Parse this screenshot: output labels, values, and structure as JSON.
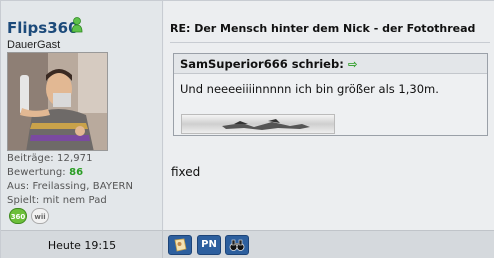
{
  "user": {
    "name": "Flips360",
    "title": "DauerGast",
    "stats": {
      "posts_label": "Beiträge:",
      "posts_value": "12,971",
      "rep_label": "Bewertung:",
      "rep_value": "86",
      "loc_label": "Aus:",
      "loc_value": "Freilassing, BAYERN",
      "plays_label": "Spielt:",
      "plays_value": "mit nem Pad"
    },
    "badges": [
      "360",
      "wii"
    ]
  },
  "post": {
    "title": "RE: Der Mensch hinter dem Nick - der Fotothread",
    "quote": {
      "author": "SamSuperior666 schrieb:",
      "arrow": "⇨",
      "text": "Und neeeeiiiinnnnn ich bin größer als 1,30m."
    },
    "message": "fixed"
  },
  "footer": {
    "time": "Heute 19:15",
    "pn_label": "PN"
  },
  "colors": {
    "username": "#1c4a7a",
    "reputation": "#2a9d24",
    "button": "#2d5f9e"
  }
}
